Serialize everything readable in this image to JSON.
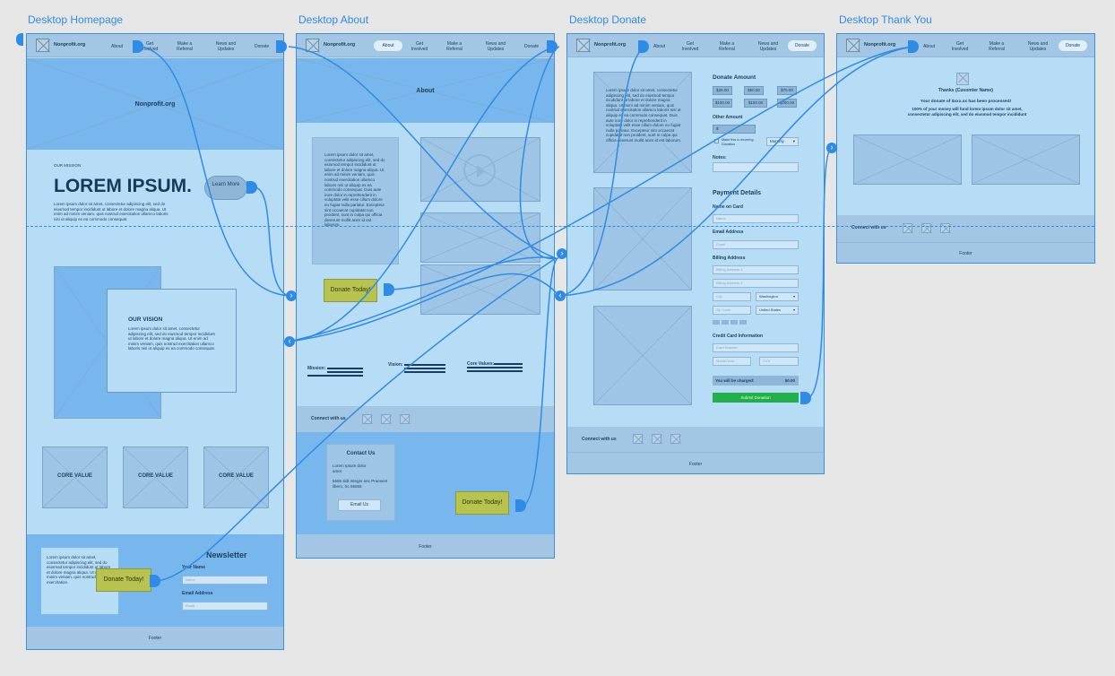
{
  "frames": {
    "home": {
      "label": "Desktop Homepage"
    },
    "about": {
      "label": "Desktop About"
    },
    "donate": {
      "label": "Desktop Donate"
    },
    "thanks": {
      "label": "Desktop Thank You"
    }
  },
  "nav": {
    "brand": "Nonprofit.org",
    "about": "About",
    "get_involved": "Get Involved",
    "referral": "Make a Referral",
    "news": "News and Updates",
    "donate": "Donate"
  },
  "home": {
    "hero_title": "Nonprofit.org",
    "mission_label": "OUR MISSION",
    "headline": "LOREM IPSUM.",
    "headline_body": "Lorem ipsum dolor sit amet, consectetur adipiscing elit, sed do eiusmod tempor incididunt ut labore et dolore magna aliqua. Ut enim ad minim veniam, quis nostrud exercitation ullamco laboris nisi ut aliquip ex ea commodo consequat.",
    "learn_more": "Learn More",
    "vision_title": "OUR VISION",
    "vision_body": "Lorem ipsum dolor sit amet, consectetur adipiscing elit, sed do eiusmod tempor incididunt ut labore et dolore magna aliqua. Ut enim ad minim veniam, quis nostrud exercitation ullamco laboris nisi ut aliquip ex ea commodo consequat.",
    "core_values": [
      "CORE VALUE",
      "CORE VALUE",
      "CORE VALUE"
    ],
    "newsletter_body": "Lorem ipsum dolor sit amet, consectetur adipiscing elit, sed do eiusmod tempor incididunt ut labore et dolore magna aliqua. Ut enim ad minim veniam, quis nostrud exercitation.",
    "donate_today": "Donate Today!",
    "newsletter_title": "Newsletter",
    "your_name": "Your Name",
    "name_placeholder": "Name",
    "email_label": "Email Address",
    "email_placeholder": "Email",
    "footer": "Footer"
  },
  "about": {
    "hero_title": "About",
    "body": "Lorem ipsum dolor sit amet, consectetur adipiscing elit, sed do eiusmod tempor incididunt ut labore et dolore magna aliqua. Ut enim ad minim veniam, quis nostrud exercitation ullamco laboris nisi ut aliquip ex ea commodo consequat. Duis aute irure dolor in reprehenderit in voluptate velit esse cillum dolore eu fugiat nulla pariatur. Excepteur sint occaecat cupidatat non proident, sunt in culpa qui officia deserunt mollit anim id est laborum.",
    "donate_today": "Donate Today!",
    "mission": "Mission:",
    "vision": "Vision:",
    "core_values": "Core Values:",
    "connect": "Connect with us",
    "contact_title": "Contact Us",
    "contact_name": "Lorem Ipsum dolor amet",
    "contact_address": "5555 sldt Integer nec Praesent libero, Sc 55555",
    "email_us": "Email Us",
    "donate_today_2": "Donate Today!",
    "footer": "Footer"
  },
  "donate": {
    "body": "Lorem ipsum dolor sit amet, consectetur adipiscing elit, sed do eiusmod tempor incididunt ut labore et dolore magna aliqua. Ut enim ad minim veniam, quis nostrud exercitation ullamco laboris nisi ut aliquip ex ea commodo consequat. Duis aute irure dolor in reprehenderit in voluptate velit esse cillum dolore eu fugiat nulla pariatur. Excepteur sint occaecat cupidatat non proident, sunt in culpa qui officia deserunt mollit anim id est laborum.",
    "amount_title": "Donate Amount",
    "amounts": [
      "$25.00",
      "$50.00",
      "$75.00",
      "$100.00",
      "$150.00",
      "$200.00"
    ],
    "other_amount": "Other Amount",
    "dollar": "$",
    "recurring": "Make this a recurring Donation",
    "frequency": "Monthly",
    "notes": "Notes:",
    "payment_title": "Payment Details",
    "name_on_card": "Name on Card",
    "name_placeholder": "Name",
    "email_label": "Email Address",
    "email_placeholder": "Email",
    "billing_label": "Billing Address",
    "billing_1": "Billing Address 1",
    "billing_2": "Billing Address 2",
    "city": "City",
    "state": "Washington",
    "zip": "Zip Code",
    "country": "United States",
    "cc_label": "Credit Card Information",
    "card_number": "Card Number",
    "month_year": "Month/Year",
    "cvv": "CVV",
    "charged_label": "You will be charged:",
    "charged_value": "$0.00",
    "submit": "Submit Donation",
    "connect": "Connect with us",
    "footer": "Footer"
  },
  "thanks": {
    "name": "Thanks {Cusomter Name}",
    "processed": "Your donate of $xxx.xx has been processed!",
    "message": "100% of your money will fund lorem ipsum dolor sit amet, consectetur adipiscing elit, sed do eiusmod tempor incididunt",
    "connect": "Connect with us",
    "footer": "Footer"
  },
  "colors": {
    "link": "#2e8ce6",
    "frame_bg": "#b7dcf6",
    "button": "#b8c24f",
    "submit": "#22b04b"
  }
}
